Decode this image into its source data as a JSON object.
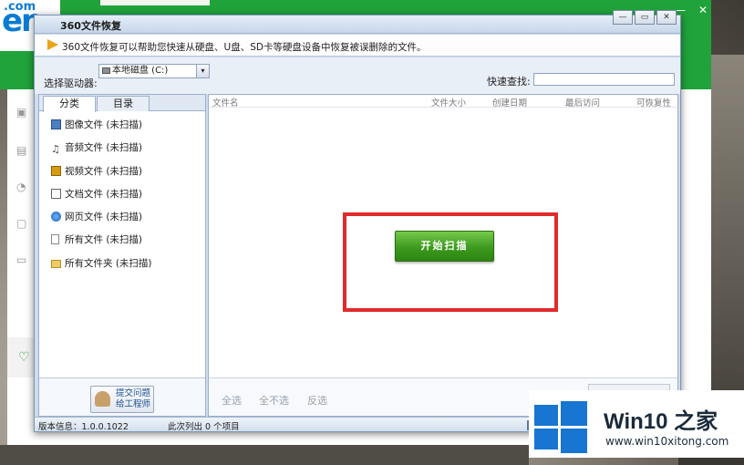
{
  "background_app": {
    "logo_text": "en",
    "logo_domain": ".com"
  },
  "dialog": {
    "title": "360文件恢复",
    "description": "360文件恢复可以帮助您快速从硬盘、U盘、SD卡等硬盘设备中恢复被误删除的文件。",
    "drive_label": "选择驱动器:",
    "drive_value": "本地磁盘 (C:)",
    "search_label": "快速查找:",
    "search_value": "",
    "tabs": [
      "分类",
      "目录"
    ],
    "categories": [
      {
        "label": "图像文件 (未扫描)",
        "icon": "image-icon"
      },
      {
        "label": "音频文件 (未扫描)",
        "icon": "music-icon"
      },
      {
        "label": "视频文件 (未扫描)",
        "icon": "video-icon"
      },
      {
        "label": "文档文件 (未扫描)",
        "icon": "document-icon"
      },
      {
        "label": "网页文件 (未扫描)",
        "icon": "web-icon"
      },
      {
        "label": "所有文件 (未扫描)",
        "icon": "file-icon"
      },
      {
        "label": "所有文件夹 (未扫描)",
        "icon": "folder-icon"
      }
    ],
    "columns": [
      "文件名",
      "文件大小",
      "创建日期",
      "最后访问",
      "可恢复性"
    ],
    "scan_button": "开始扫描",
    "feedback_button": "提交问题\n给工程师",
    "select_all": "全选",
    "select_none": "全不选",
    "invert": "反选",
    "status_version": "版本信息：1.0.0.1022",
    "status_count": "此次列出 0 个项目"
  },
  "watermark": {
    "title": "Win10 之家",
    "url": "www.win10xitong.com"
  },
  "colors": {
    "accent_green": "#20a33a",
    "highlight_red": "#e12a2a",
    "watermark_blue": "#1875d2"
  }
}
